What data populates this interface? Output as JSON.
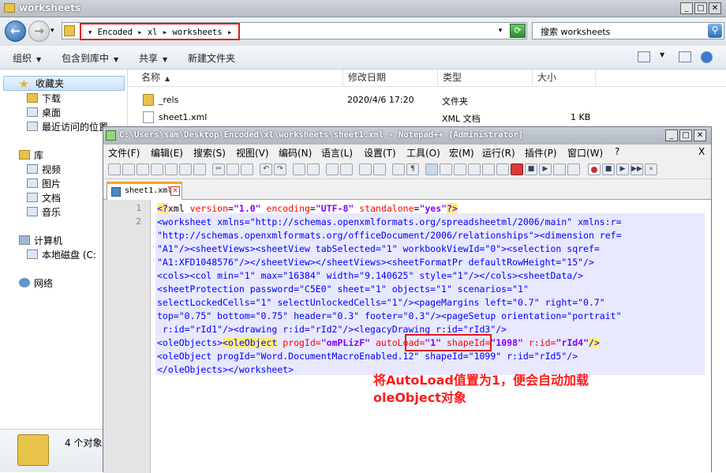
{
  "explorer": {
    "title": "worksheets",
    "breadcrumb": "▾ Encoded ▸ xl ▸ worksheets ▸",
    "breadcrumb_parts": [
      "Encoded",
      "xl",
      "worksheets"
    ],
    "search_placeholder": "搜索 worksheets",
    "toolbar": {
      "organize": "组织",
      "include": "包含到库中",
      "share": "共享",
      "new_folder": "新建文件夹"
    },
    "nav": {
      "favorites": "收藏夹",
      "downloads": "下载",
      "desktop": "桌面",
      "recent": "最近访问的位置",
      "library": "库",
      "videos": "视频",
      "pictures": "图片",
      "documents": "文档",
      "music": "音乐",
      "computer": "计算机",
      "local_disk": "本地磁盘 (C:",
      "network": "网络"
    },
    "columns": {
      "name": "名称",
      "modified": "修改日期",
      "type": "类型",
      "size": "大小"
    },
    "files": [
      {
        "name": "_rels",
        "modified": "2020/4/6 17:20",
        "type": "文件夹",
        "size": ""
      },
      {
        "name": "sheet1.xml",
        "modified": "",
        "type": "XML 文档",
        "size": "1 KB"
      }
    ],
    "item_count": "4 个对象"
  },
  "notepad": {
    "title": "C:\\Users\\sam\\Desktop\\Encoded\\xl\\worksheets\\sheet1.xml - Notepad++ [Administrator]",
    "menu": [
      "文件(F)",
      "编辑(E)",
      "搜索(S)",
      "视图(V)",
      "编码(N)",
      "语言(L)",
      "设置(T)",
      "工具(O)",
      "宏(M)",
      "运行(R)",
      "插件(P)",
      "窗口(W)",
      "?",
      "X"
    ],
    "tab_label": "sheet1.xml",
    "line_numbers": [
      "1",
      "2"
    ],
    "code": {
      "l1_pi_open": "<?",
      "l1_decl": "xml ",
      "l1_a1": "version",
      "l1_v1": "\"1.0\"",
      "l1_a2": "encoding",
      "l1_v2": "\"UTF-8\"",
      "l1_a3": "standalone",
      "l1_v3": "\"yes\"",
      "l1_pi_close": "?>",
      "l2": "<worksheet xmlns=\"http://schemas.openxmlformats.org/spreadsheetml/2006/main\" xmlns:r=",
      "l3": "\"http://schemas.openxmlformats.org/officeDocument/2006/relationships\"><dimension ref=",
      "l4": "\"A1\"/><sheetViews><sheetView tabSelected=\"1\" workbookViewId=\"0\"><selection sqref=",
      "l5": "\"A1:XFD1048576\"/></sheetView></sheetViews><sheetFormatPr defaultRowHeight=\"15\"/>",
      "l6": "<cols><col min=\"1\" max=\"16384\" width=\"9.140625\" style=\"1\"/></cols><sheetData/>",
      "l7": "<sheetProtection password=\"C5E0\" sheet=\"1\" objects=\"1\" scenarios=\"1\"",
      "l8": "selectLockedCells=\"1\" selectUnlockedCells=\"1\"/><pageMargins left=\"0.7\" right=\"0.7\"",
      "l9": "top=\"0.75\" bottom=\"0.75\" header=\"0.3\" footer=\"0.3\"/><pageSetup orientation=\"portrait\"",
      "l10": " r:id=\"rId1\"/><drawing r:id=\"rId2\"/><legacyDrawing r:id=\"rId3\"/>",
      "l11_a": "<oleObjects>",
      "l11_b": "<oleObject",
      "l11_c": " progId=",
      "l11_d": "\"omPLizF\"",
      "l11_e": " autoLoad=",
      "l11_f": "\"1\"",
      "l11_g": " shapeId=",
      "l11_h": "\"1098\"",
      "l11_i": " r:id=",
      "l11_j": "\"rId4\"",
      "l11_k": "/>",
      "l12": "<oleObject progId=\"Word.DocumentMacroEnabled.12\" shapeId=\"1099\" r:id=\"rId5\"/>",
      "l13": "</oleObjects></worksheet>"
    },
    "annotation_line1": "将AutoLoad值置为1，便会自动加载",
    "annotation_line2": "oleObject对象"
  },
  "colors": {
    "annotation": "#e01c1c",
    "highlight_line": "#e8e8ff",
    "tag_blue": "#0000ff",
    "attr_red": "#ff0000",
    "value_purple": "#8000ff"
  }
}
